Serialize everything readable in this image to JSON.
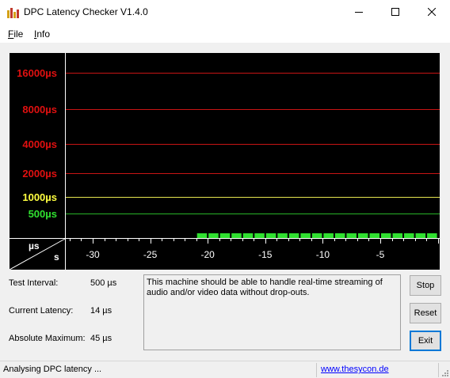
{
  "window": {
    "title": "DPC Latency Checker V1.4.0"
  },
  "menu": {
    "file_rest": "ile",
    "file_key": "F",
    "info_rest": "nfo",
    "info_key": "I"
  },
  "graph": {
    "y_ticks": [
      {
        "label": "16000µs",
        "color": "#e01010"
      },
      {
        "label": "8000µs",
        "color": "#e01010"
      },
      {
        "label": "4000µs",
        "color": "#e01010"
      },
      {
        "label": "2000µs",
        "color": "#e01010"
      },
      {
        "label": "1000µs",
        "color": "#ffff40"
      },
      {
        "label": "500µs",
        "color": "#30e030"
      }
    ],
    "x_ticks": [
      "-30",
      "-25",
      "-20",
      "-15",
      "-10",
      "-5"
    ],
    "corner_top": "µs",
    "corner_bottom": "s",
    "bar_color": "#30e030"
  },
  "chart_data": {
    "type": "bar",
    "xlabel": "s",
    "ylabel": "µs",
    "x_ticks": [
      -30,
      -25,
      -20,
      -15,
      -10,
      -5
    ],
    "y_ticks": [
      500,
      1000,
      2000,
      4000,
      8000,
      16000
    ],
    "recent_window_seconds": 21,
    "latency_us_approx": 14
  },
  "info": {
    "test_interval_label": "Test Interval:",
    "test_interval_value": "500 µs",
    "current_latency_label": "Current Latency:",
    "current_latency_value": "14 µs",
    "absolute_max_label": "Absolute Maximum:",
    "absolute_max_value": "45 µs",
    "message": "This machine should be able to handle real-time streaming of audio and/or video data without drop-outs."
  },
  "buttons": {
    "stop": "Stop",
    "reset": "Reset",
    "exit": "Exit"
  },
  "status": {
    "text": "Analysing DPC latency ...",
    "link": "www.thesycon.de"
  }
}
